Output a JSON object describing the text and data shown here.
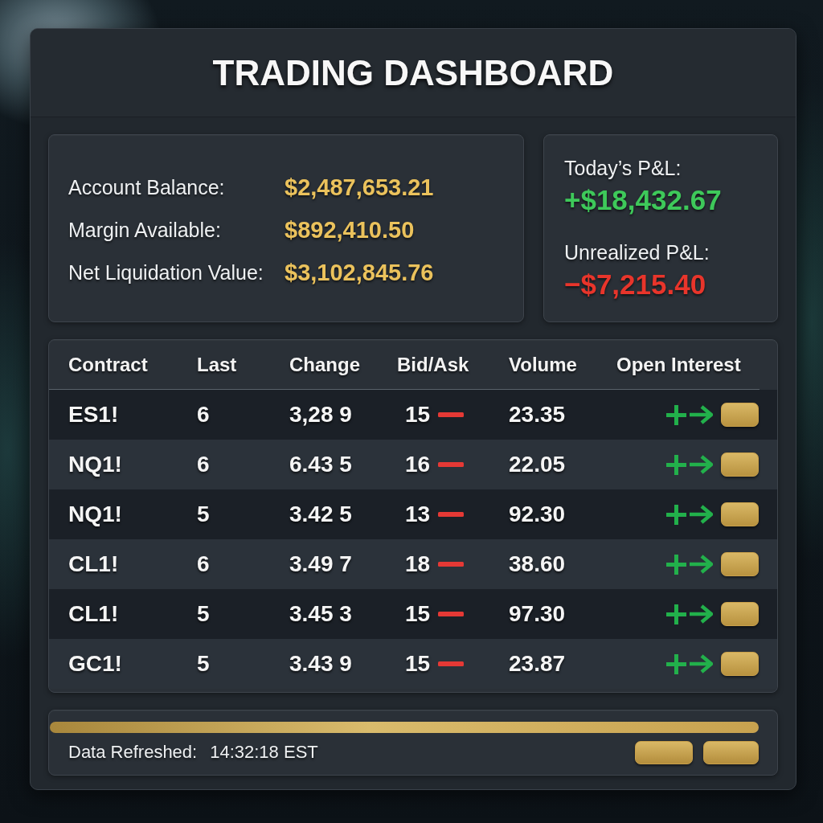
{
  "title": "TRADING DASHBOARD",
  "account": [
    {
      "label": "Account Balance:",
      "value": "$2,487,653.21"
    },
    {
      "label": "Margin Available:",
      "value": "$892,410.50"
    },
    {
      "label": "Net Liquidation Value:",
      "value": "$3,102,845.76"
    }
  ],
  "pnl": [
    {
      "label": "Today’s P&L:",
      "value": "+$18,432.67",
      "color": "#3ec95a"
    },
    {
      "label": "Unrealized P&L:",
      "value": "−$7,215.40",
      "color": "#e8352b"
    }
  ],
  "table": {
    "columns": [
      "Contract",
      "Last",
      "Change",
      "Bid/Ask",
      "Volume",
      "Open Interest"
    ],
    "rows": [
      {
        "contract": "ES1!",
        "last": "6",
        "change": "3,28 9",
        "bid_ask": "15",
        "volume": "23.35"
      },
      {
        "contract": "NQ1!",
        "last": "6",
        "change": "6.43 5",
        "bid_ask": "16",
        "volume": "22.05"
      },
      {
        "contract": "NQ1!",
        "last": "5",
        "change": "3.42 5",
        "bid_ask": "13",
        "volume": "92.30"
      },
      {
        "contract": "CL1!",
        "last": "6",
        "change": "3.49 7",
        "bid_ask": "18",
        "volume": "38.60"
      },
      {
        "contract": "CL1!",
        "last": "5",
        "change": "3.45 3",
        "bid_ask": "15",
        "volume": "97.30"
      },
      {
        "contract": "GC1!",
        "last": "5",
        "change": "3.43 9",
        "bid_ask": "15",
        "volume": "23.87"
      }
    ]
  },
  "footer": {
    "label": "Data Refreshed:",
    "time": "14:32:18 EST"
  }
}
